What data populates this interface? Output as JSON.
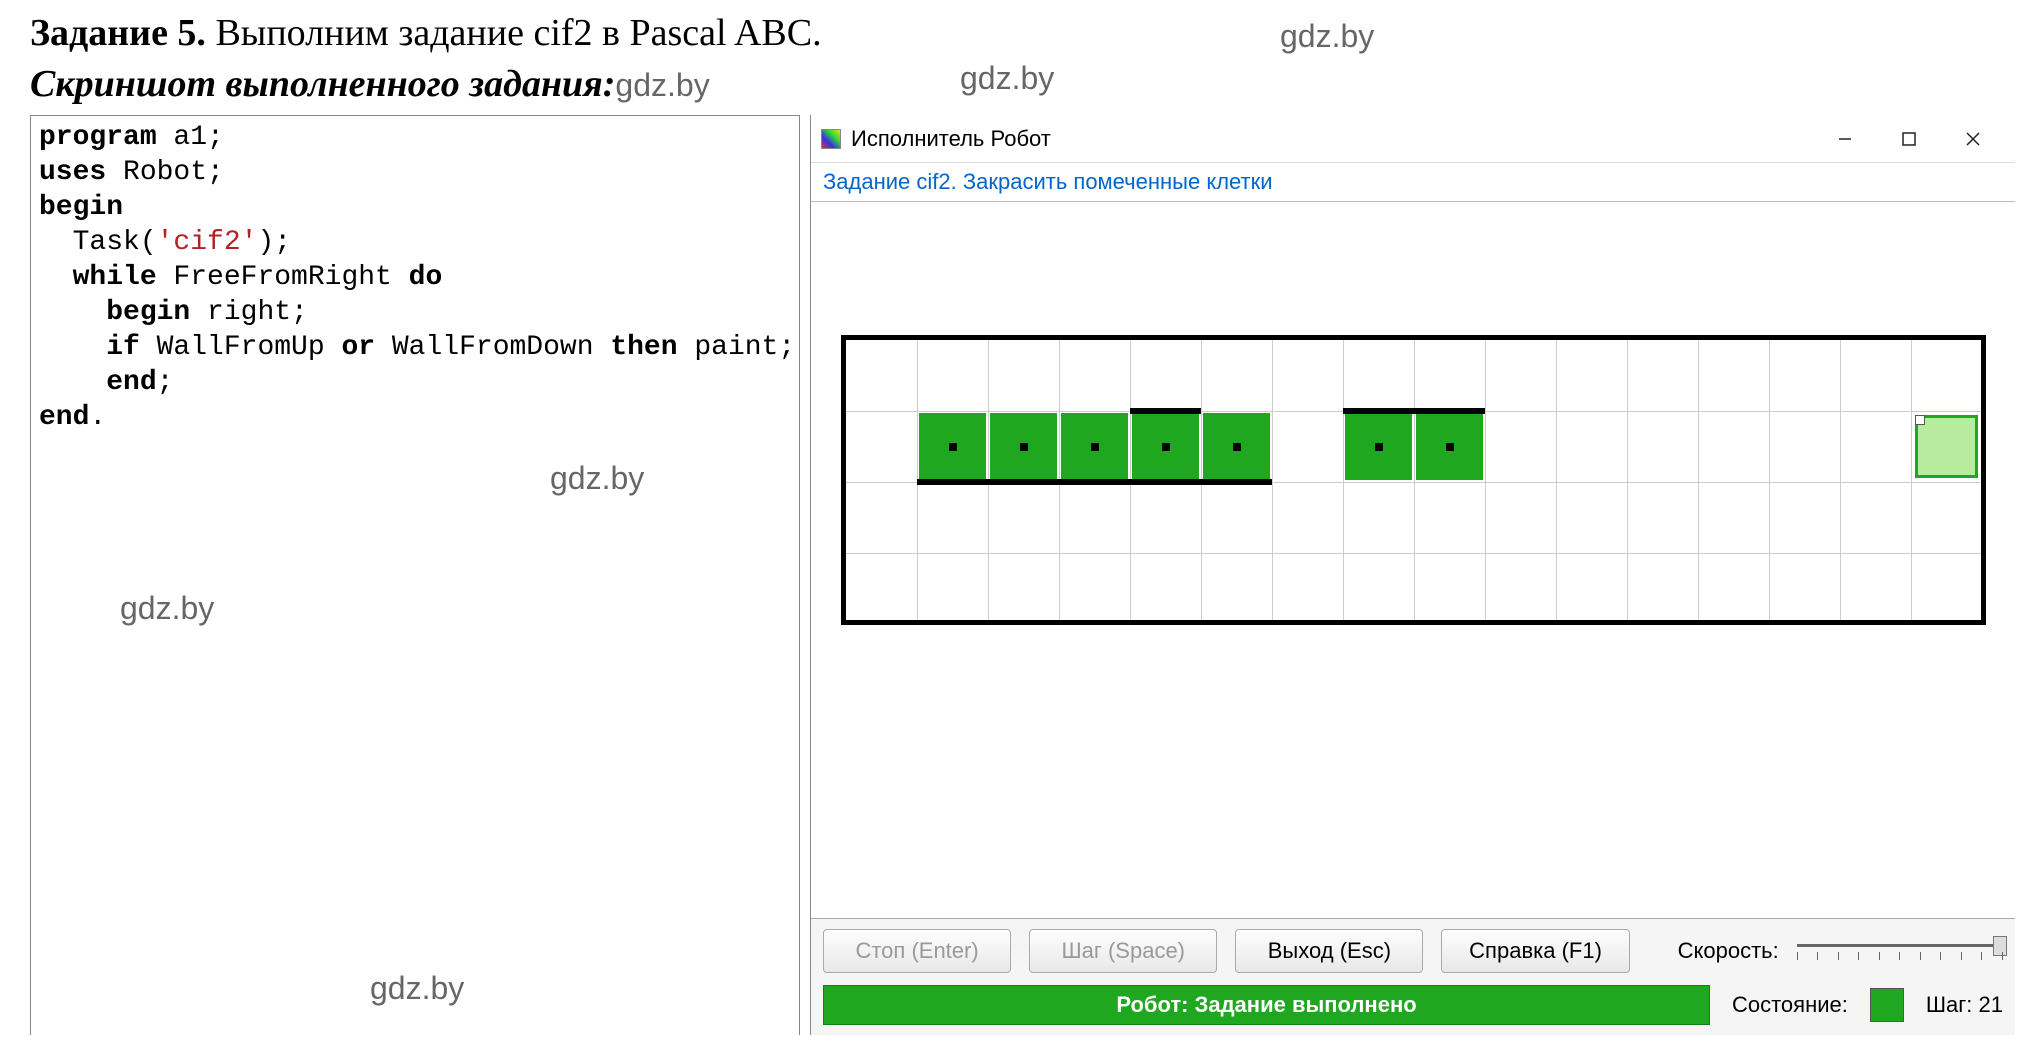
{
  "header": {
    "task_prefix": "Задание 5.",
    "task_text": " Выполним задание cif2 в Pascal ABC.",
    "subtitle": "Скриншот выполненного задания:",
    "subtitle_wm": "gdz.by"
  },
  "watermarks": [
    "gdz.by",
    "gdz.by",
    "gdz.by",
    "gdz.by",
    "gdz.by",
    "gdz.by",
    "gdz.by",
    "gdz.by",
    "gdz.by"
  ],
  "code": {
    "l1_kw": "program",
    "l1_id": " a1;",
    "l2_kw": "uses",
    "l2_id": " Robot;",
    "l3_kw": "begin",
    "l4_fn": "  Task(",
    "l4_str": "'cif2'",
    "l4_close": ");",
    "l5_kw1": "  while",
    "l5_id": " FreeFromRight ",
    "l5_kw2": "do",
    "l6_kw": "    begin",
    "l6_id": " right;",
    "l7_kw1": "    if",
    "l7_id1": " WallFromUp ",
    "l7_kw2": "or",
    "l7_id2": " WallFromDown ",
    "l7_kw3": "then",
    "l7_id3": " paint;",
    "l8_kw": "    end",
    "l8_sc": ";",
    "l9_kw": "end",
    "l9_dot": "."
  },
  "robot": {
    "window_title": "Исполнитель Робот",
    "task_label": "Задание cif2. Закрасить помеченные клетки",
    "buttons": {
      "stop": "Стоп (Enter)",
      "step": "Шаг (Space)",
      "exit": "Выход (Esc)",
      "help": "Справка (F1)"
    },
    "speed_label": "Скорость:",
    "status_text": "Робот: Задание выполнено",
    "state_label": "Состояние:",
    "step_label": "Шаг: 21"
  },
  "grid": {
    "cols": 16,
    "rows": 4,
    "cell": 71,
    "painted_cols_row1": [
      1,
      2,
      3,
      4,
      5,
      7,
      8
    ],
    "robot_col_row1": 15,
    "top_walls_row1": [
      [
        4,
        4
      ],
      [
        7,
        8
      ]
    ],
    "bottom_walls_row1": [
      [
        1,
        3
      ],
      [
        4,
        5
      ]
    ]
  }
}
